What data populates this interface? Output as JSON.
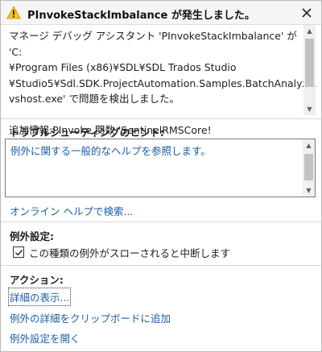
{
  "window": {
    "title": "PInvokeStackImbalance が発生しました。"
  },
  "message": {
    "text": "マネージ デバッグ アシスタント 'PInvokeStackImbalance' が 'C:\n¥Program Files (x86)¥SDL¥SDL Trados Studio\n¥Studio5¥Sdl.SDK.ProjectAutomation.Samples.BatchAnalyze.\nvshost.exe' で問題を検出しました。\n\n追加情報:PInvoke 関数 'SentinelRMSCore!"
  },
  "troubleshooting": {
    "heading": "トラブルシューティングのヒント:",
    "hint_link": "例外に関する一般的なヘルプを参照します。",
    "online_help_link": "オンライン ヘルプで検索..."
  },
  "exception_settings": {
    "heading": "例外設定:",
    "checkbox_label": "この種類の例外がスローされると中断します",
    "checked": true
  },
  "actions": {
    "heading": "アクション:",
    "items": [
      "詳細の表示...",
      "例外の詳細をクリップボードに追加",
      "例外設定を開く"
    ]
  },
  "colors": {
    "link": "#1a5ea8",
    "warning_fill": "#f7c21b"
  },
  "icons": {
    "title": "warning-icon",
    "close": "close-icon",
    "checkbox": "checkmark-icon"
  }
}
